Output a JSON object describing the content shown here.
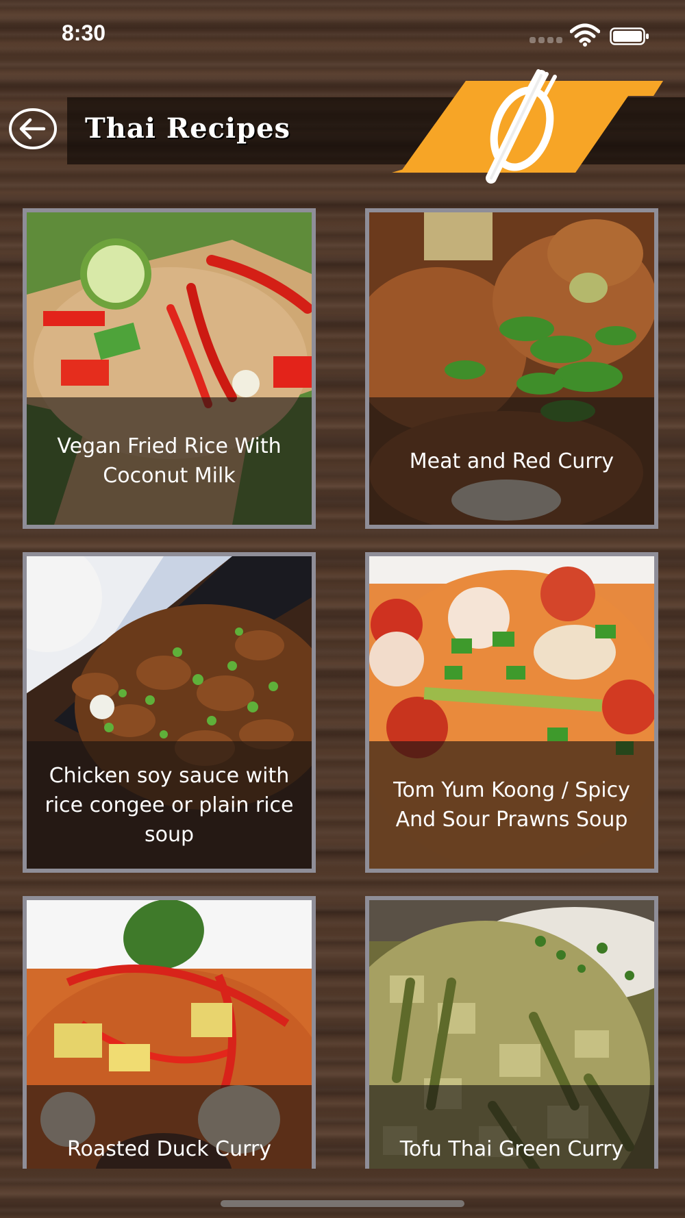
{
  "status_bar": {
    "time": "8:30"
  },
  "header": {
    "title": "Thai Recipes"
  },
  "recipes": [
    {
      "title": "Vegan Fried Rice With Coconut Milk"
    },
    {
      "title": "Meat and Red Curry"
    },
    {
      "title": "Chicken soy sauce with rice congee or plain rice soup"
    },
    {
      "title": "Tom Yum Koong / Spicy And Sour Prawns Soup"
    },
    {
      "title": "Roasted Duck Curry"
    },
    {
      "title": "Tofu Thai Green Curry"
    }
  ],
  "colors": {
    "accent": "#f5a225",
    "card_border": "#8f8e98",
    "header_bar": "#1a110c"
  },
  "icons": [
    "back-arrow-icon",
    "fork-knife-logo-icon",
    "wifi-icon",
    "battery-icon",
    "cellular-signal-icon"
  ]
}
